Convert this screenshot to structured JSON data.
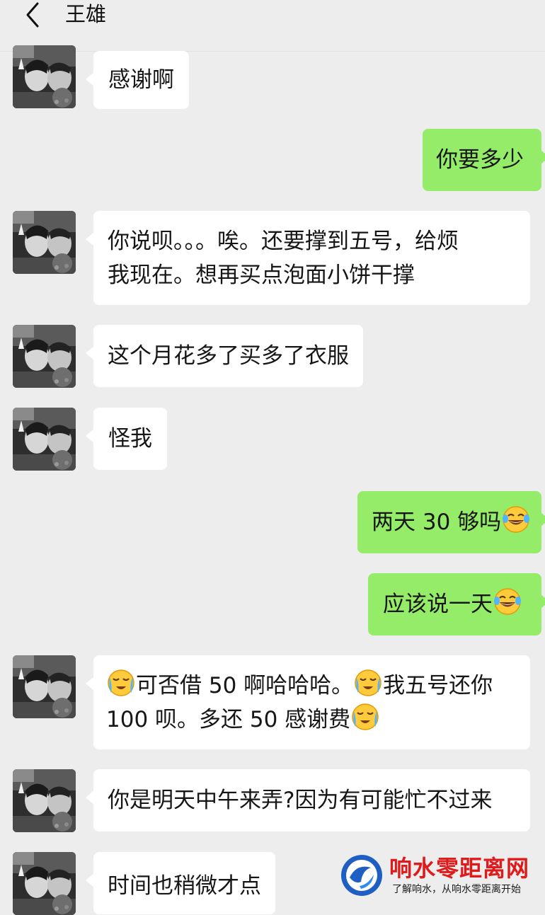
{
  "header": {
    "title": "王雄",
    "back_icon": "chevron-left-icon"
  },
  "contact": {
    "avatar_desc": "avatar-photo"
  },
  "messages": [
    {
      "side": "in",
      "text": "感谢啊"
    },
    {
      "side": "out",
      "text": "你要多少"
    },
    {
      "side": "in",
      "lines": [
        "你说呗。。。唉。还要撑到五号，给烦",
        "我现在。想再买点泡面小饼干撑"
      ]
    },
    {
      "side": "in",
      "text": "这个月花多了买多了衣服"
    },
    {
      "side": "in",
      "text": "怪我"
    },
    {
      "side": "out",
      "text": "两天 30 够吗"
    },
    {
      "side": "out",
      "text": "应该说一天"
    },
    {
      "side": "in",
      "parts": [
        "可否借 50 啊哈哈哈。",
        "我五号还你",
        "100 呗。多还 50 感谢费"
      ]
    },
    {
      "side": "in",
      "text": "你是明天中午来弄?因为有可能忙不过来"
    },
    {
      "side": "in",
      "text": "时间也稍微才点"
    }
  ],
  "emojis": {
    "tears_of_joy": "tears-of-joy-emoji",
    "crying_laughing": "laughing-crying-emoji"
  },
  "watermark": {
    "name": "响水零距离网",
    "slogan": "了解响水，从响水零距离开始"
  },
  "colors": {
    "background": "#ededed",
    "bubble_in": "#ffffff",
    "bubble_out": "#95ec69",
    "watermark_red": "#e01a1a"
  }
}
